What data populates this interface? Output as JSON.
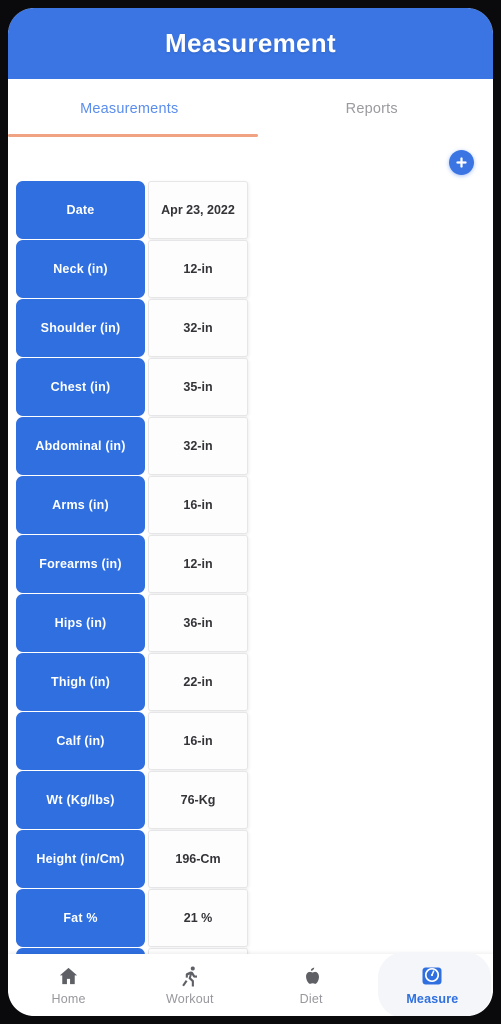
{
  "app": {
    "title": "Measurement",
    "header_color": "#3a75e3"
  },
  "tabs": [
    {
      "label": "Measurements",
      "active": true,
      "indicator_color": "#f0a283"
    },
    {
      "label": "Reports",
      "active": false
    }
  ],
  "actions": {
    "add_label": "+",
    "add_icon": "plus-icon",
    "add_color": "#3a75e3"
  },
  "measurements": {
    "rows": [
      {
        "label": "Date",
        "value": "Apr 23, 2022"
      },
      {
        "label": "Neck (in)",
        "value": "12-in"
      },
      {
        "label": "Shoulder (in)",
        "value": "32-in"
      },
      {
        "label": "Chest (in)",
        "value": "35-in"
      },
      {
        "label": "Abdominal (in)",
        "value": "32-in"
      },
      {
        "label": "Arms (in)",
        "value": "16-in"
      },
      {
        "label": "Forearms (in)",
        "value": "12-in"
      },
      {
        "label": "Hips (in)",
        "value": "36-in"
      },
      {
        "label": "Thigh (in)",
        "value": "22-in"
      },
      {
        "label": "Calf (in)",
        "value": "16-in"
      },
      {
        "label": "Wt (Kg/lbs)",
        "value": "76-Kg"
      },
      {
        "label": "Height (in/Cm)",
        "value": "196-Cm"
      },
      {
        "label": "Fat %",
        "value": "21  %"
      }
    ],
    "label_color": "#2f6fe0",
    "value_color": "#333338"
  },
  "bottom_nav": {
    "items": [
      {
        "label": "Home",
        "icon": "home-icon",
        "active": false
      },
      {
        "label": "Workout",
        "icon": "runner-icon",
        "active": false
      },
      {
        "label": "Diet",
        "icon": "apple-icon",
        "active": false
      },
      {
        "label": "Measure",
        "icon": "scale-icon",
        "active": true
      }
    ],
    "active_color": "#2f6fe0",
    "inactive_color": "#97979d"
  }
}
